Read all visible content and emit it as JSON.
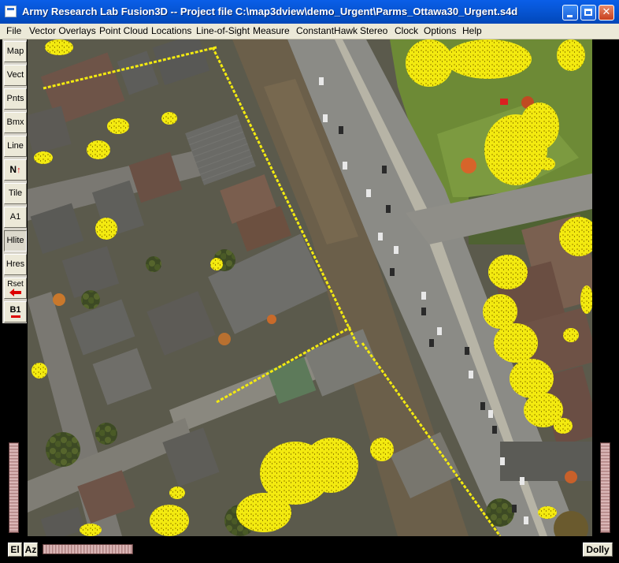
{
  "window": {
    "title": "Army Research Lab Fusion3D -- Project file C:\\map3dview\\demo_Urgent\\Parms_Ottawa30_Urgent.s4d",
    "minimize_glyph": "",
    "maximize_glyph": "",
    "close_glyph": "✕"
  },
  "menu": {
    "items": [
      {
        "label": "File"
      },
      {
        "label": "Vector Overlays"
      },
      {
        "label": "Point Cloud"
      },
      {
        "label": "Locations"
      },
      {
        "label": "Line-of-Sight"
      },
      {
        "label": "Measure"
      },
      {
        "label": "ConstantHawk"
      },
      {
        "label": "Stereo"
      },
      {
        "label": "Clock"
      },
      {
        "label": "Options"
      },
      {
        "label": "Help"
      }
    ]
  },
  "toolbar": {
    "map": "Map",
    "vect": "Vect",
    "pnts": "Pnts",
    "bmx": "Bmx",
    "line": "Line",
    "north": "N",
    "north_arrow": "↑",
    "tile": "Tile",
    "a1": "A1",
    "hlite": "Hlite",
    "hres": "Hres",
    "rset": "Rset",
    "b1": "B1"
  },
  "bottom": {
    "el": "El",
    "az": "Az",
    "dolly": "Dolly"
  },
  "colors": {
    "highlight": "#f5ee12",
    "road": "#8a8a86",
    "grass": "#5e7a34",
    "titlebar": "#0756d6"
  },
  "icons": {
    "app": "app-window-icon",
    "map": "aerial-map-view"
  }
}
